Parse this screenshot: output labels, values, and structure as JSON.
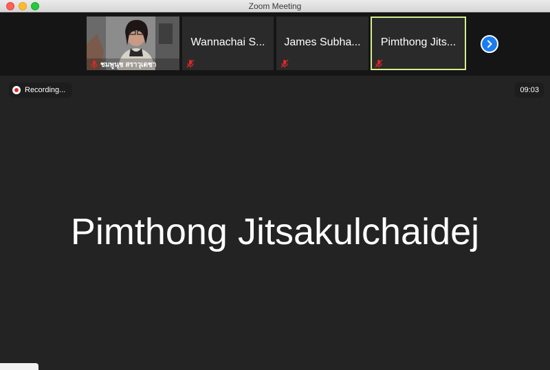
{
  "window": {
    "title": "Zoom Meeting"
  },
  "participants": {
    "video_tile": {
      "name": "ชมพูนุช สราวุเดชา"
    },
    "tiles": [
      {
        "name": "Wannachai S..."
      },
      {
        "name": "James Subha..."
      },
      {
        "name": "Pimthong Jits..."
      }
    ],
    "active_tile_index": 2
  },
  "recording": {
    "label": "Recording..."
  },
  "timer": {
    "value": "09:03"
  },
  "active_speaker": {
    "name": "Pimthong Jitsakulchaidej"
  },
  "colors": {
    "active_border": "#d6f08c",
    "next_button": "#1a7cf4",
    "mute_icon": "#e02828"
  },
  "icons": {
    "mute": "mic-muted-icon",
    "next": "chevron-right-icon",
    "record": "record-icon"
  }
}
